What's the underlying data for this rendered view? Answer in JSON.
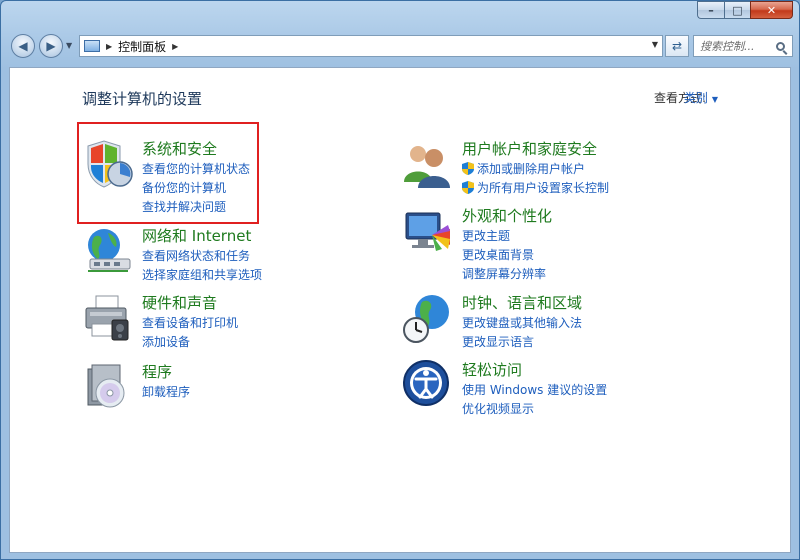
{
  "window": {
    "controls": {
      "minimize": "–",
      "maximize": "□",
      "close": "✕"
    }
  },
  "address_bar": {
    "breadcrumb": "控制面板",
    "search_placeholder": "搜索控制...",
    "icons": [
      "back-arrow-icon",
      "forward-arrow-icon",
      "control-panel-icon",
      "refresh-icon",
      "search-icon"
    ]
  },
  "main": {
    "title": "调整计算机的设置",
    "view_by_label": "查看方式:",
    "view_by_value": "类别"
  },
  "categories": [
    {
      "title": "系统和安全",
      "icon": "shield-icon",
      "links": [
        "查看您的计算机状态",
        "备份您的计算机",
        "查找并解决问题"
      ]
    },
    {
      "title": "网络和 Internet",
      "icon": "network-globe-icon",
      "links": [
        "查看网络状态和任务",
        "选择家庭组和共享选项"
      ]
    },
    {
      "title": "硬件和声音",
      "icon": "printer-icon",
      "links": [
        "查看设备和打印机",
        "添加设备"
      ]
    },
    {
      "title": "程序",
      "icon": "programs-disc-icon",
      "links": [
        "卸载程序"
      ]
    },
    {
      "title": "用户帐户和家庭安全",
      "icon": "users-icon",
      "links": [
        "添加或删除用户帐户",
        "为所有用户设置家长控制"
      ]
    },
    {
      "title": "外观和个性化",
      "icon": "monitor-palette-icon",
      "links": [
        "更改主题",
        "更改桌面背景",
        "调整屏幕分辨率"
      ]
    },
    {
      "title": "时钟、语言和区域",
      "icon": "globe-clock-icon",
      "links": [
        "更改键盘或其他输入法",
        "更改显示语言"
      ]
    },
    {
      "title": "轻松访问",
      "icon": "accessibility-icon",
      "links": [
        "使用 Windows 建议的设置",
        "优化视频显示"
      ]
    }
  ],
  "colors": {
    "category_title": "#1e7a1e",
    "link": "#1e5ebd",
    "highlight": "#e02020"
  }
}
